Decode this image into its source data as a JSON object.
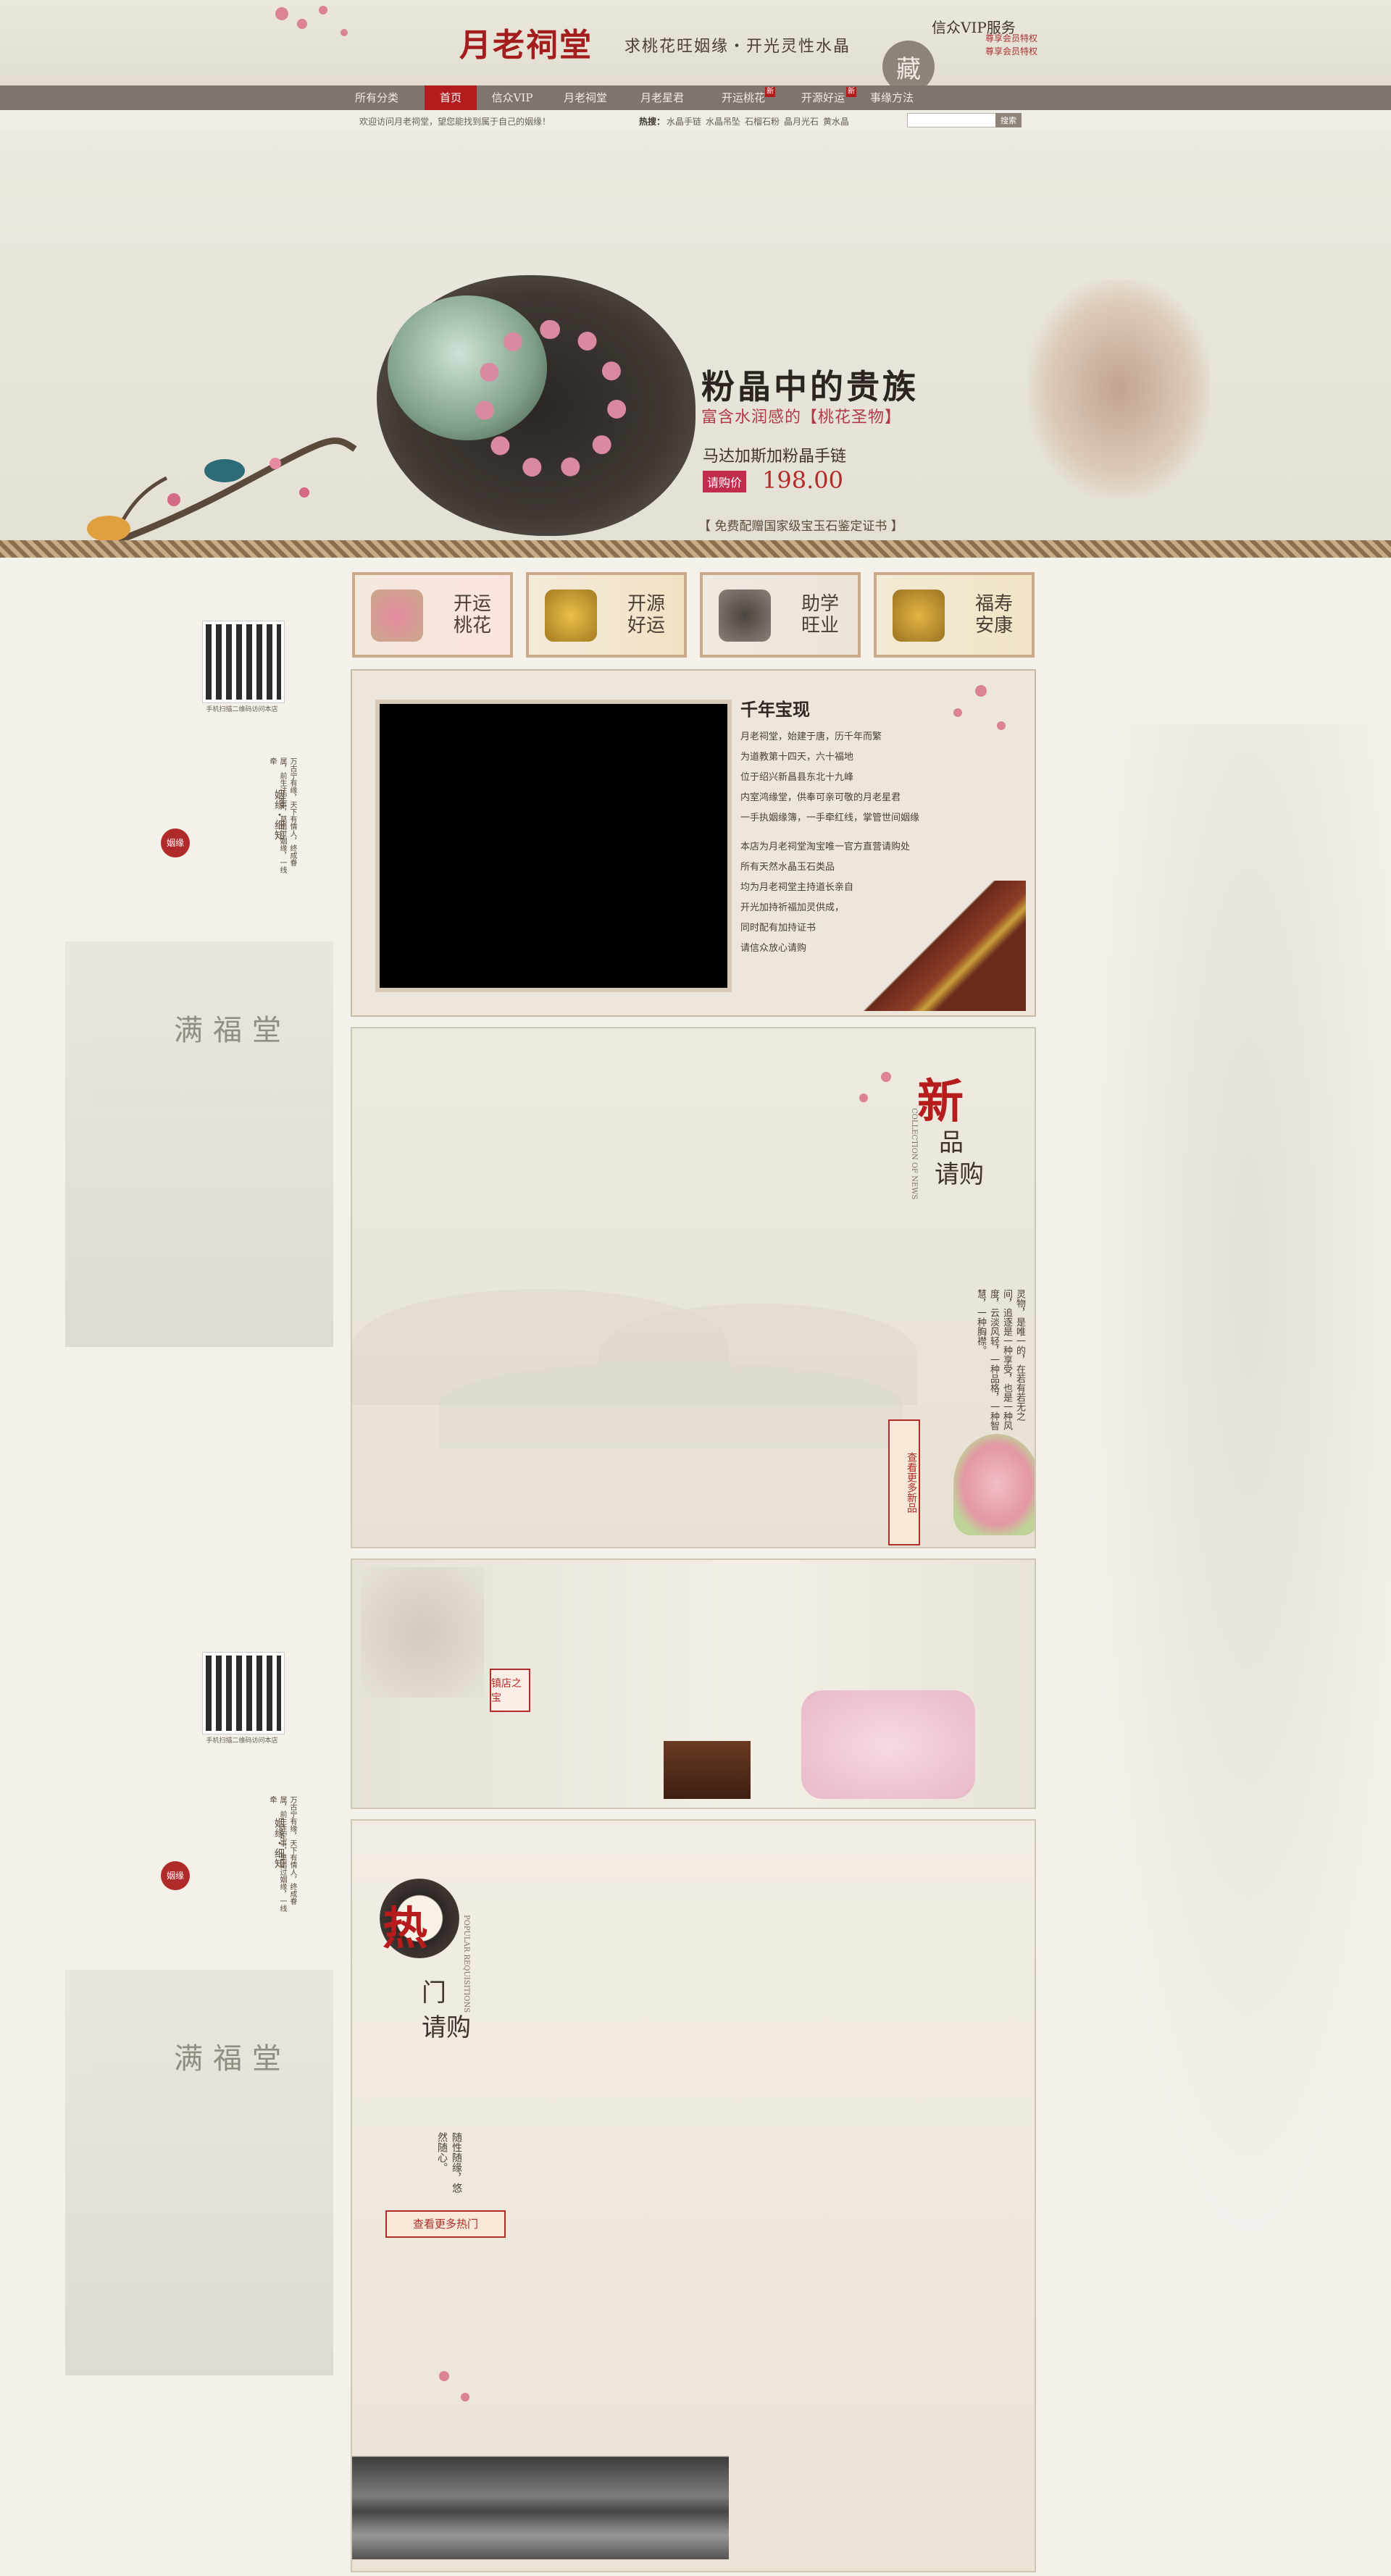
{
  "header": {
    "logo": "月老祠堂",
    "slogan": "求桃花旺姻缘・开光灵性水晶",
    "vip_title": "信众VIP服务",
    "vip_line1": "尊享会员特权",
    "vip_line2": "尊享会员特权",
    "vip_seal": "藏"
  },
  "nav": {
    "items": [
      {
        "label": "所有分类"
      },
      {
        "label": "首页"
      },
      {
        "label": "信众VIP"
      },
      {
        "label": "月老祠堂"
      },
      {
        "label": "月老星君"
      },
      {
        "label": "开运桃花"
      },
      {
        "label": "开源好运"
      },
      {
        "label": "事缘方法"
      }
    ],
    "new_badge": "新"
  },
  "subbar": {
    "welcome": "欢迎访问月老祠堂，望您能找到属于自己的姻缘！",
    "hot_label": "热搜：",
    "hot_links": [
      "水晶手链",
      "水晶吊坠",
      "石榴石粉",
      "晶月光石",
      "黄水晶"
    ],
    "search_placeholder": "",
    "search_button": "搜索"
  },
  "hero": {
    "headline": "粉晶中的贵族",
    "sub_prefix": "富含水润感的",
    "sub_highlight": "【桃花圣物】",
    "product": "马达加斯加粉晶手链",
    "price_label": "请购价",
    "price": "198.00",
    "cert_note": "【 免费配赠国家级宝玉石鉴定证书 】"
  },
  "sidebar": {
    "qr_caption": "手机扫描二维码访问本店",
    "poem": "万古宁有缘，天下有情人，终成眷属，前生注定事，莫错过姻缘，一线牵",
    "seal": "姻缘",
    "brand_vertical": "姻缘・细知",
    "building_sign": "满福堂"
  },
  "categories": [
    {
      "line1": "开运",
      "line2": "桃花"
    },
    {
      "line1": "开源",
      "line2": "好运"
    },
    {
      "line1": "助学",
      "line2": "旺业"
    },
    {
      "line1": "福寿",
      "line2": "安康"
    }
  ],
  "about": {
    "title": "千年宝现",
    "lines": [
      "月老祠堂，始建于唐，历千年而繁",
      "为道教第十四天，六十福地",
      "位于绍兴新昌县东北十九峰",
      "内室鸿缘堂，供奉可亲可敬的月老星君",
      "一手执姻缘簿，一手牵红线，掌管世间姻缘",
      "本店为月老祠堂淘宝唯一官方直营请购处",
      "所有天然水晶玉石类品",
      "均为月老祠堂主持道长亲自",
      "开光加持祈福加灵供成，",
      "同时配有加持证书",
      "请信众放心请购"
    ]
  },
  "new_section": {
    "char": "新",
    "line1": "品",
    "line2": "请购",
    "english": "COLLECTION OF NEWS",
    "poem": "灵物，是唯一的，在若有若无之间，追逐是一种享受，也是一种风度，云淡风轻，一种品格，一种智慧，一种胸襟。",
    "more": "查看更多新品"
  },
  "banner": {
    "seal": "镇店之宝"
  },
  "hot_section": {
    "char": "热",
    "line1": "门",
    "line2": "请购",
    "english": "POPULAR REQUISITIONS",
    "poem": "随性随缘，悠然随心。",
    "more": "查看更多热门"
  }
}
